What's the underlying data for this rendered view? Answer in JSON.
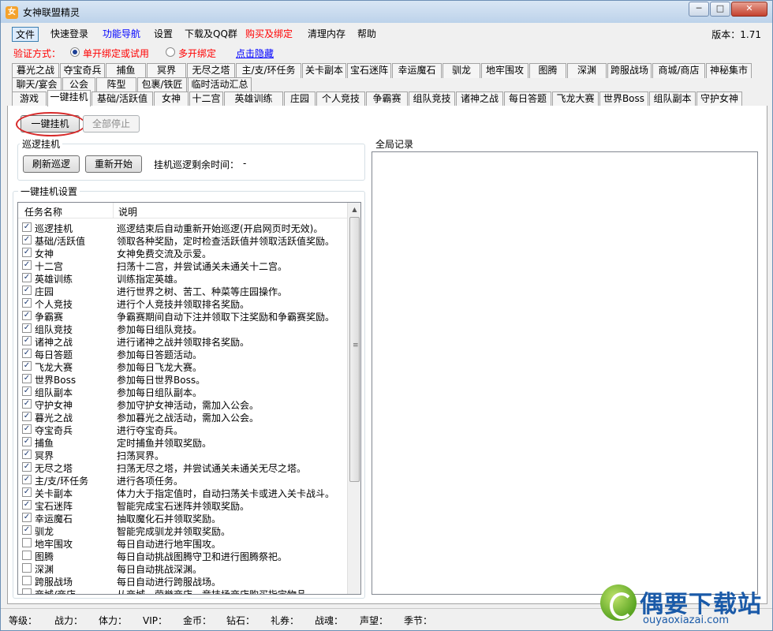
{
  "window": {
    "title": "女神联盟精灵",
    "icon": "app-icon"
  },
  "menu": {
    "items": [
      {
        "label": "文件",
        "color": "#000000"
      },
      {
        "label": "快速登录",
        "color": "#000000"
      },
      {
        "label": "功能导航",
        "color": "#0000ff"
      },
      {
        "label": "设置",
        "color": "#000000"
      },
      {
        "label": "下载及QQ群",
        "color": "#000000"
      },
      {
        "label": "购买及绑定",
        "color": "#ff0000"
      },
      {
        "label": "清理内存",
        "color": "#000000"
      },
      {
        "label": "帮助",
        "color": "#000000"
      }
    ],
    "version": "版本：1.71"
  },
  "auth": {
    "label": "验证方式：",
    "option1": "单开绑定或试用",
    "option2": "多开绑定",
    "hide_link": "点击隐藏",
    "selected": "单开绑定或试用"
  },
  "tabs": {
    "row1": [
      "暮光之战",
      "夺宝奇兵",
      "捕鱼",
      "冥界",
      "无尽之塔",
      "主/支/环任务",
      "关卡副本",
      "宝石迷阵",
      "幸运魔石",
      "驯龙",
      "地牢围攻",
      "图腾",
      "深渊",
      "跨服战场",
      "商城/商店",
      "神秘集市"
    ],
    "row2": [
      "聊天/宴会",
      "公会",
      "阵型",
      "包裹/铁匠",
      "临时活动汇总"
    ],
    "row3": [
      "游戏",
      "一键挂机",
      "基础/活跃值",
      "女神",
      "十二宫",
      "英雄训练",
      "庄园",
      "个人竞技",
      "争霸赛",
      "组队竞技",
      "诸神之战",
      "每日答题",
      "飞龙大赛",
      "世界Boss",
      "组队副本",
      "守护女神"
    ],
    "active": "一键挂机"
  },
  "main": {
    "one_click_btn": "一键挂机",
    "stop_all_btn": "全部停止",
    "patrol": {
      "title": "巡逻挂机",
      "refresh_btn": "刷新巡逻",
      "restart_btn": "重新开始",
      "remaining_label": "挂机巡逻剩余时间：",
      "remaining_value": "-"
    },
    "settings_title": "一键挂机设置",
    "log_title": "全局记录",
    "columns": [
      "任务名称",
      "说明"
    ],
    "tasks": [
      {
        "name": "巡逻挂机",
        "desc": "巡逻结束后自动重新开始巡逻(开启网页时无效)。",
        "checked": true
      },
      {
        "name": "基础/活跃值",
        "desc": "领取各种奖励，定时检查活跃值并领取活跃值奖励。",
        "checked": true
      },
      {
        "name": "女神",
        "desc": "女神免费交流及示爱。",
        "checked": true
      },
      {
        "name": "十二宫",
        "desc": "扫荡十二宫，并尝试通关未通关十二宫。",
        "checked": true
      },
      {
        "name": "英雄训练",
        "desc": "训练指定英雄。",
        "checked": true
      },
      {
        "name": "庄园",
        "desc": "进行世界之树、苦工、种菜等庄园操作。",
        "checked": true
      },
      {
        "name": "个人竞技",
        "desc": "进行个人竞技并领取排名奖励。",
        "checked": true
      },
      {
        "name": "争霸赛",
        "desc": "争霸赛期间自动下注并领取下注奖励和争霸赛奖励。",
        "checked": true
      },
      {
        "name": "组队竞技",
        "desc": "参加每日组队竞技。",
        "checked": true
      },
      {
        "name": "诸神之战",
        "desc": "进行诸神之战并领取排名奖励。",
        "checked": true
      },
      {
        "name": "每日答题",
        "desc": "参加每日答题活动。",
        "checked": true
      },
      {
        "name": "飞龙大赛",
        "desc": "参加每日飞龙大赛。",
        "checked": true
      },
      {
        "name": "世界Boss",
        "desc": "参加每日世界Boss。",
        "checked": true
      },
      {
        "name": "组队副本",
        "desc": "参加每日组队副本。",
        "checked": true
      },
      {
        "name": "守护女神",
        "desc": "参加守护女神活动，需加入公会。",
        "checked": true
      },
      {
        "name": "暮光之战",
        "desc": "参加暮光之战活动，需加入公会。",
        "checked": true
      },
      {
        "name": "夺宝奇兵",
        "desc": "进行夺宝奇兵。",
        "checked": true
      },
      {
        "name": "捕鱼",
        "desc": "定时捕鱼并领取奖励。",
        "checked": true
      },
      {
        "name": "冥界",
        "desc": "扫荡冥界。",
        "checked": true
      },
      {
        "name": "无尽之塔",
        "desc": "扫荡无尽之塔，并尝试通关未通关无尽之塔。",
        "checked": true
      },
      {
        "name": "主/支/环任务",
        "desc": "进行各项任务。",
        "checked": true
      },
      {
        "name": "关卡副本",
        "desc": "体力大于指定值时，自动扫荡关卡或进入关卡战斗。",
        "checked": true
      },
      {
        "name": "宝石迷阵",
        "desc": "智能完成宝石迷阵并领取奖励。",
        "checked": true
      },
      {
        "name": "幸运魔石",
        "desc": "抽取魔化石并领取奖励。",
        "checked": true
      },
      {
        "name": "驯龙",
        "desc": "智能完成驯龙并领取奖励。",
        "checked": true
      },
      {
        "name": "地牢围攻",
        "desc": "每日自动进行地牢围攻。",
        "checked": false
      },
      {
        "name": "图腾",
        "desc": "每日自动挑战图腾守卫和进行图腾祭祀。",
        "checked": false
      },
      {
        "name": "深渊",
        "desc": "每日自动挑战深渊。",
        "checked": false
      },
      {
        "name": "跨服战场",
        "desc": "每日自动进行跨服战场。",
        "checked": false
      },
      {
        "name": "商城/商店",
        "desc": "从商城、荣誉商店、竞技场商店购买指定物品。",
        "checked": false
      }
    ]
  },
  "status": [
    "等级：",
    "战力：",
    "体力：",
    "VIP：",
    "金币：",
    "钻石：",
    "礼券：",
    "战魂：",
    "声望：",
    "季节："
  ],
  "watermark": {
    "text": "偶要下载站",
    "url": "ouyaoxiazai.com"
  }
}
